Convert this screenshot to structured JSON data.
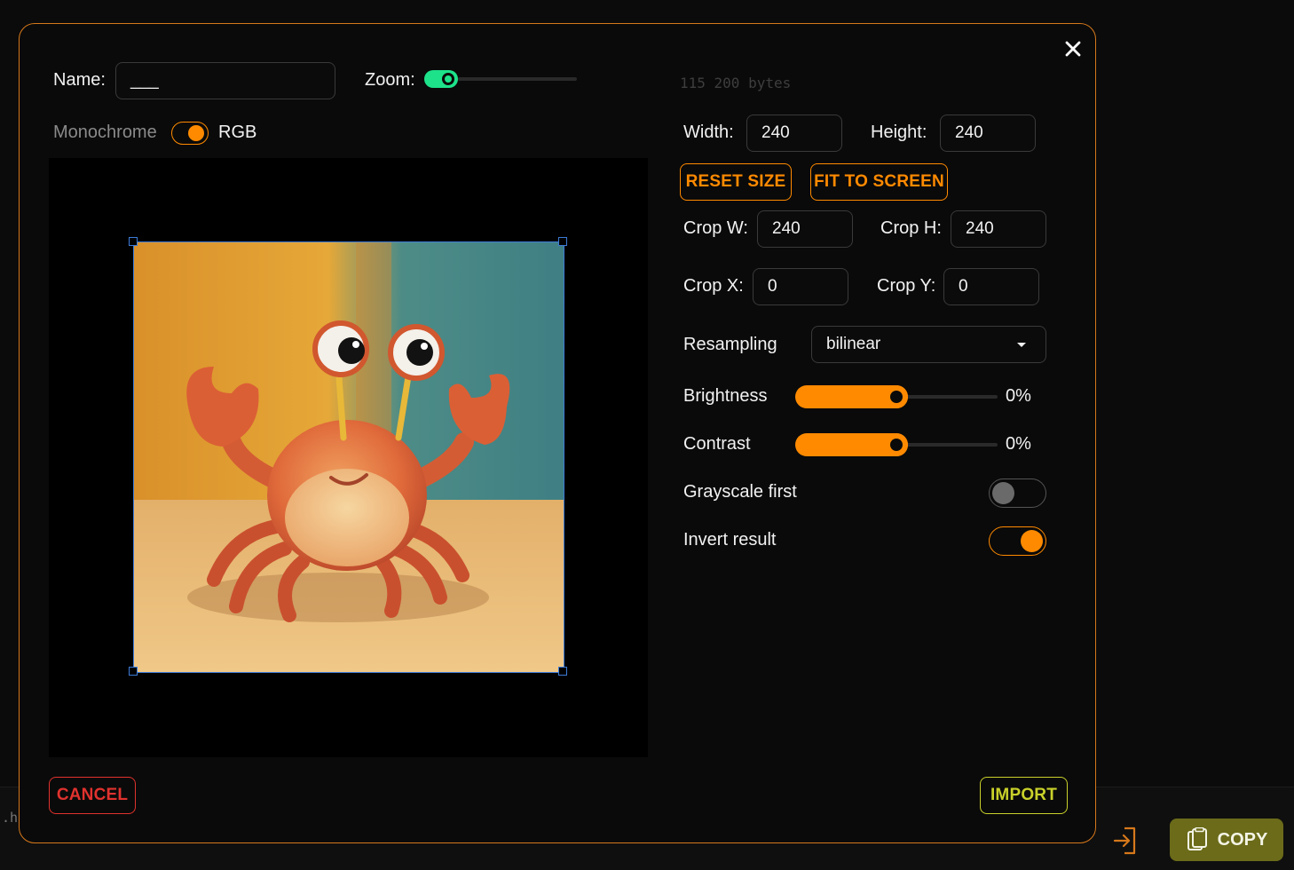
{
  "background": {
    "code_fragment": ".h\"",
    "copy_label": "COPY"
  },
  "dialog": {
    "name_label": "Name:",
    "name_value": "___",
    "zoom_label": "Zoom:",
    "zoom_on": true,
    "zoom_level": 0,
    "bytes_text": "115 200 bytes",
    "mode_off_label": "Monochrome",
    "mode_on_label": "RGB",
    "mode_rgb": true,
    "width_label": "Width:",
    "width_value": "240",
    "height_label": "Height:",
    "height_value": "240",
    "reset_size_label": "RESET SIZE",
    "fit_to_screen_label": "FIT TO SCREEN",
    "crop_w_label": "Crop W:",
    "crop_w_value": "240",
    "crop_h_label": "Crop H:",
    "crop_h_value": "240",
    "crop_x_label": "Crop X:",
    "crop_x_value": "0",
    "crop_y_label": "Crop Y:",
    "crop_y_value": "0",
    "resampling_label": "Resampling",
    "resampling_value": "bilinear",
    "brightness_label": "Brightness",
    "brightness_value": "0%",
    "brightness_level": 0.5,
    "contrast_label": "Contrast",
    "contrast_value": "0%",
    "contrast_level": 0.5,
    "grayscale_label": "Grayscale first",
    "grayscale_on": false,
    "invert_label": "Invert result",
    "invert_on": true,
    "cancel_label": "CANCEL",
    "import_label": "IMPORT"
  },
  "colors": {
    "accent": "#ff8a00",
    "dialog_border": "#d6781b",
    "zoom_toggle": "#1de28a",
    "cancel": "#e0322e",
    "import": "#c9d12a",
    "crop_frame": "#3d7bd6",
    "copy_button": "#6b6b1a"
  },
  "icons": {
    "close": "close-icon",
    "import": "import-icon",
    "copy": "clipboard-icon",
    "dropdown": "caret-down-icon"
  }
}
